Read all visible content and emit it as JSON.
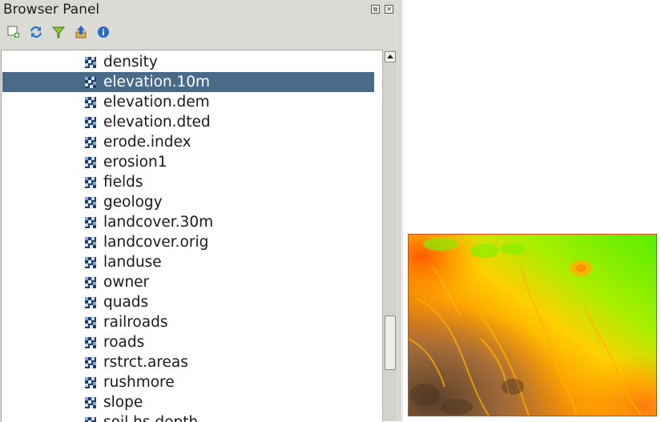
{
  "panel": {
    "title": "Browser Panel",
    "float_button": "⧉",
    "close_button": "✕"
  },
  "toolbar": [
    {
      "icon": "add-layer-icon"
    },
    {
      "icon": "refresh-icon"
    },
    {
      "icon": "filter-icon"
    },
    {
      "icon": "collapse-all-icon"
    },
    {
      "icon": "info-icon"
    }
  ],
  "tree": {
    "items": [
      {
        "label": "density",
        "selected": false
      },
      {
        "label": "elevation.10m",
        "selected": true
      },
      {
        "label": "elevation.dem",
        "selected": false
      },
      {
        "label": "elevation.dted",
        "selected": false
      },
      {
        "label": "erode.index",
        "selected": false
      },
      {
        "label": "erosion1",
        "selected": false
      },
      {
        "label": "fields",
        "selected": false
      },
      {
        "label": "geology",
        "selected": false
      },
      {
        "label": "landcover.30m",
        "selected": false
      },
      {
        "label": "landcover.orig",
        "selected": false
      },
      {
        "label": "landuse",
        "selected": false
      },
      {
        "label": "owner",
        "selected": false
      },
      {
        "label": "quads",
        "selected": false
      },
      {
        "label": "railroads",
        "selected": false
      },
      {
        "label": "roads",
        "selected": false
      },
      {
        "label": "rstrct.areas",
        "selected": false
      },
      {
        "label": "rushmore",
        "selected": false
      },
      {
        "label": "slope",
        "selected": false
      },
      {
        "label": "soil.hs.depth",
        "selected": false
      }
    ],
    "item_icon": "raster-layer-icon"
  },
  "map": {
    "layer": "elevation.10m",
    "colors": {
      "low": "#7a5a3a",
      "mid": "#ff9a00",
      "high": "#66ee00",
      "border": "#d4461c"
    }
  },
  "colors": {
    "dock_bg": "#dcdad5",
    "selection": "#4a6a8a"
  }
}
